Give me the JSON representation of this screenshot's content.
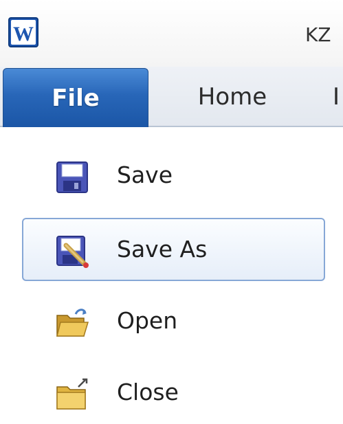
{
  "window": {
    "app_icon": "word-icon",
    "app_icon_letter": "W",
    "title_fragment": "KZ"
  },
  "ribbon": {
    "tabs": [
      {
        "label": "File",
        "active": true
      },
      {
        "label": "Home",
        "active": false
      },
      {
        "label": "I",
        "active": false
      }
    ]
  },
  "file_menu": {
    "items": [
      {
        "label": "Save",
        "icon": "floppy-disk-icon",
        "selected": false
      },
      {
        "label": "Save As",
        "icon": "save-as-icon",
        "selected": true
      },
      {
        "label": "Open",
        "icon": "open-folder-icon",
        "selected": false
      },
      {
        "label": "Close",
        "icon": "close-folder-icon",
        "selected": false
      }
    ]
  },
  "colors": {
    "file_tab": "#2866b8",
    "selection_border": "#86a7d6",
    "selection_fill": "#e6eef9"
  }
}
